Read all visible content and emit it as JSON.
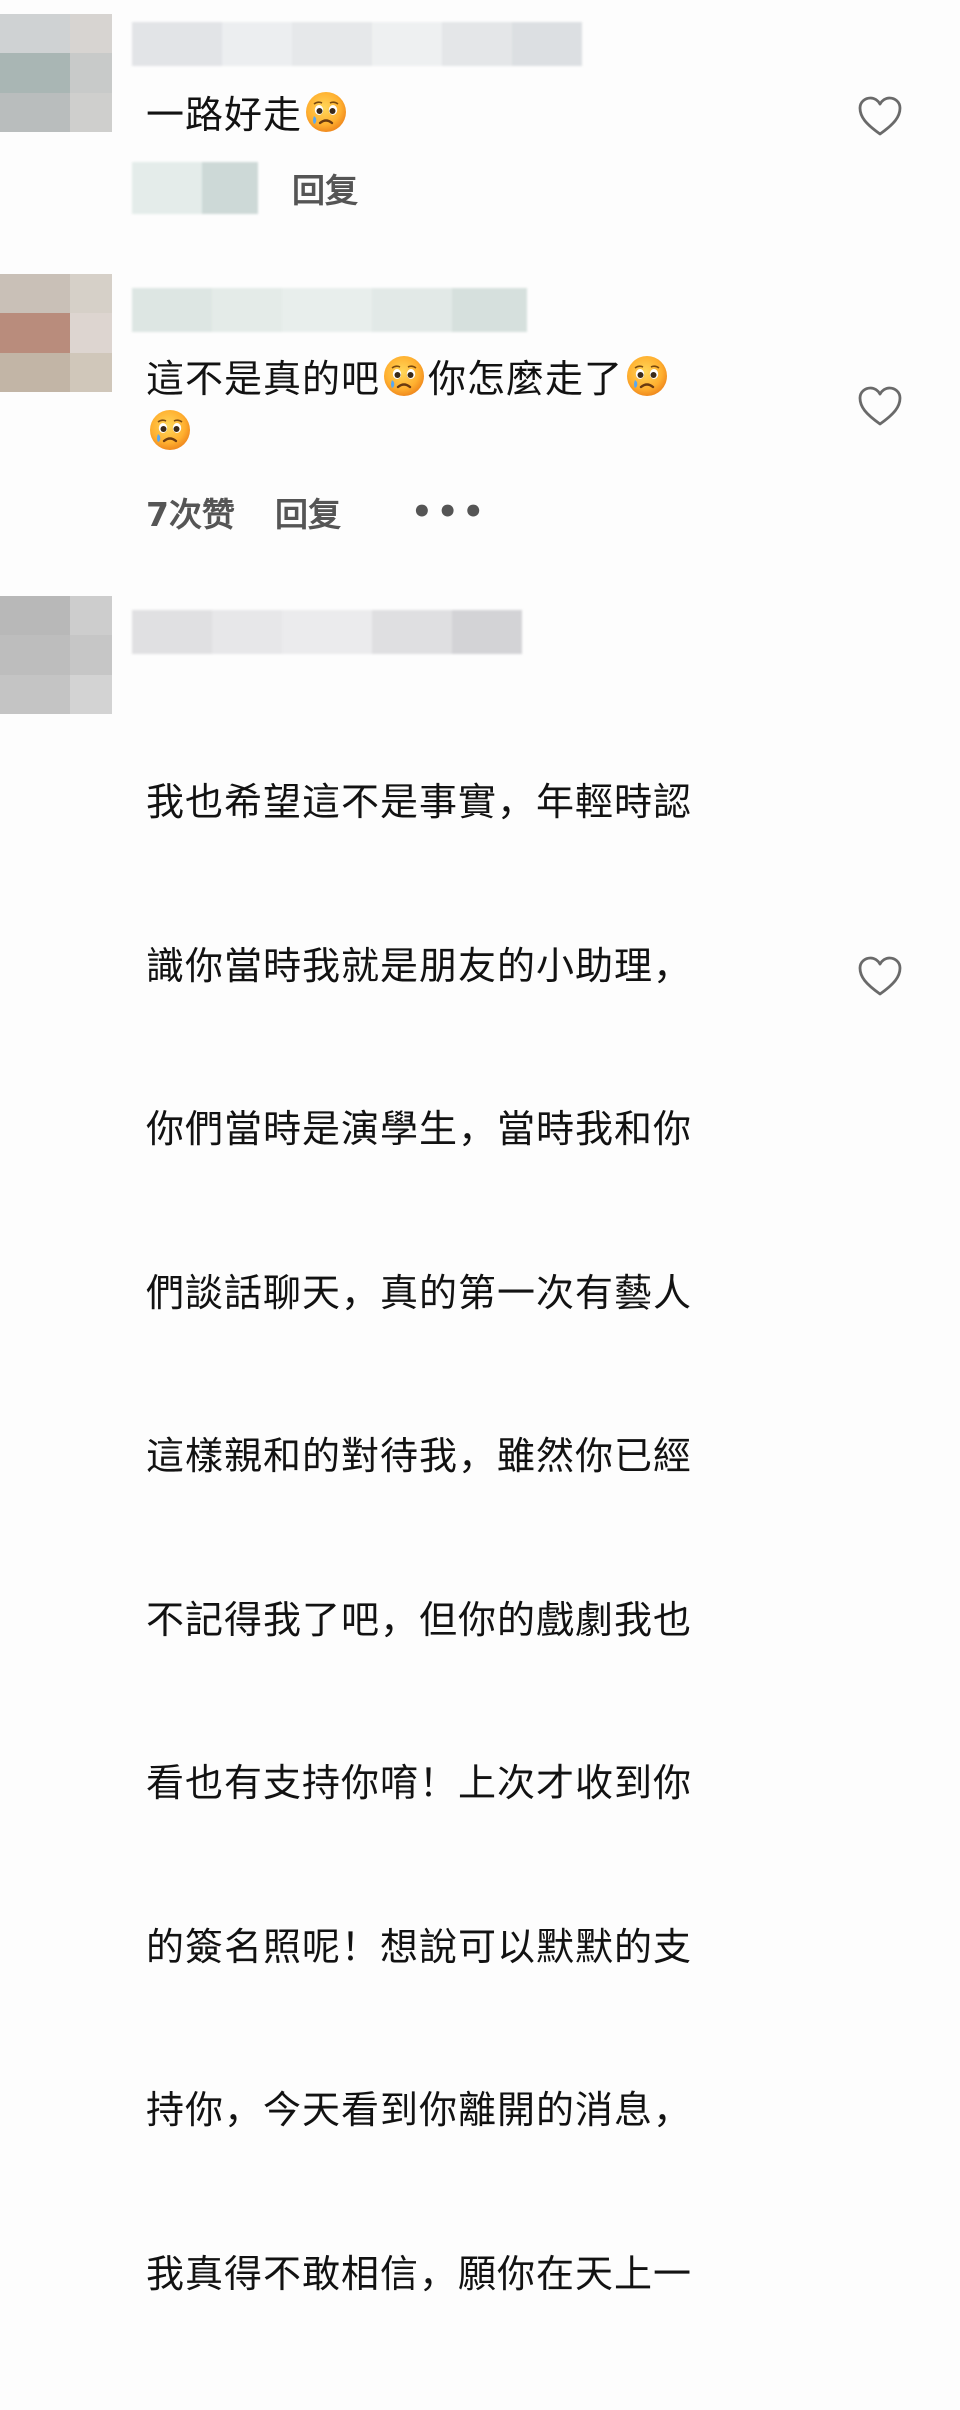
{
  "comments": [
    {
      "text": "一路好走",
      "reply_label": "回复"
    },
    {
      "text_line1": "這不是真的吧",
      "text_mid": "你怎麼走了",
      "likes_label": "7次赞",
      "reply_label": "回复",
      "more_label": "•••"
    },
    {
      "lines": [
        "我也希望這不是事實，年輕時認",
        "識你當時我就是朋友的小助理，",
        "你們當時是演學生，當時我和你",
        "們談話聊天，真的第一次有藝人",
        "這樣親和的對待我，雖然你已經",
        "不記得我了吧，但你的戲劇我也",
        "看也有支持你唷！上次才收到你",
        "的簽名照呢！想說可以默默的支",
        "持你，今天看到你離開的消息，",
        "我真得不敢相信，願你在天上一"
      ]
    }
  ],
  "icons": {
    "like": "heart-outline-icon",
    "emoji": "crying-face-emoji"
  },
  "colors": {
    "background": "#fdfdfd",
    "meta_text": "#555555",
    "heart_stroke": "#6a6a6a"
  }
}
